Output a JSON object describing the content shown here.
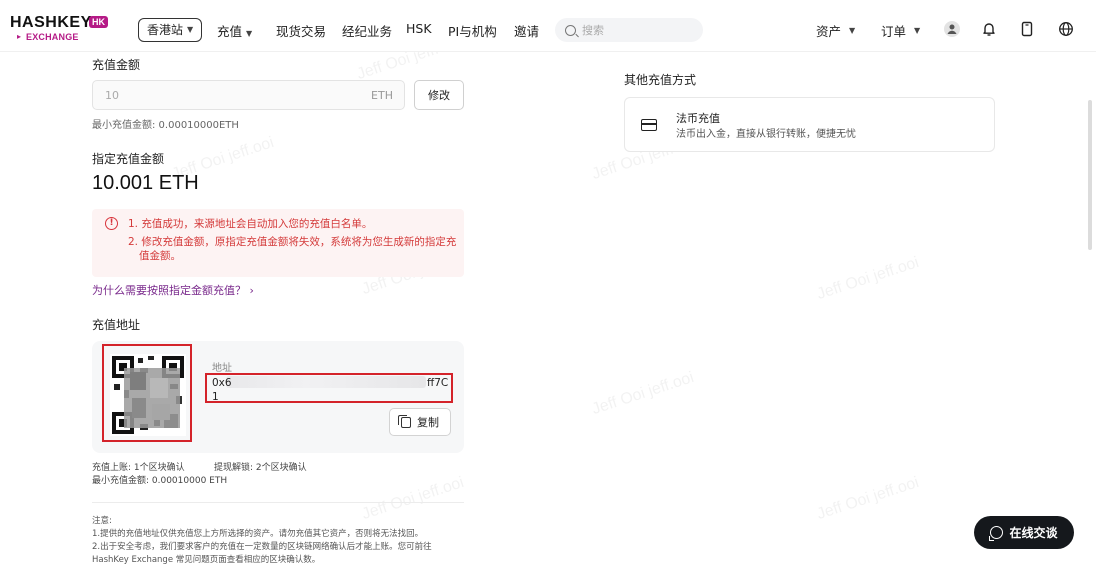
{
  "nav": {
    "logo_main": "HASHKEY",
    "logo_badge": "HK",
    "logo_sub": "EXCHANGE",
    "region": "香港站",
    "items": [
      "充值",
      "现货交易",
      "经纪业务",
      "HSK",
      "PI与机构",
      "邀请"
    ],
    "search_placeholder": "搜索",
    "assets": "资产",
    "orders": "订单",
    "icons": [
      "user-icon",
      "bell-icon",
      "phone-icon",
      "globe-icon"
    ]
  },
  "deposit": {
    "amount_label": "充值金额",
    "amount_value": "10",
    "amount_unit": "ETH",
    "modify_label": "修改",
    "min_note": "最小充值金额: 0.00010000ETH",
    "specified_label": "指定充值金额",
    "specified_amount": "10.001 ETH",
    "alert_lines": [
      "1. 充值成功，来源地址会自动加入您的充值白名单。",
      "2. 修改充值金额，原指定充值金额将失效，系统将为您生成新的指定充",
      "值金额。"
    ],
    "why_link": "为什么需要按照指定金额充值？",
    "address_section": "充值地址",
    "address_label": "地址",
    "address_start": "0x6",
    "address_end": "ff7C",
    "address_line2": "1",
    "copy_label": "复制",
    "confirm_arrival": "充值上账:  1个区块确认",
    "confirm_unlock": "提现解锁:  2个区块确认",
    "min_deposit": "最小充值金额:  0.00010000 ETH",
    "notice_title": "注意:",
    "notice_lines": [
      "1.提供的充值地址仅供充值您上方所选择的资产。请勿充值其它资产，否则将无法找回。",
      "2.出于安全考虑，我们要求客户的充值在一定数量的区块链网络确认后才能上账。您可前往",
      "HashKey Exchange 常见问题页面查看相应的区块确认数。"
    ]
  },
  "other": {
    "title": "其他充值方式",
    "fiat_title": "法币充值",
    "fiat_desc": "法币出入金，直接从银行转账，便捷无忧"
  },
  "chat": {
    "label": "在线交谈"
  },
  "watermark": "Jeff Ooi jeff.ooi",
  "colors": {
    "accent": "#b51a86",
    "alert_text": "#d43a3a",
    "alert_bg": "#fdf3f3",
    "link": "#7a2a8c",
    "highlight_box": "#d4232a"
  }
}
